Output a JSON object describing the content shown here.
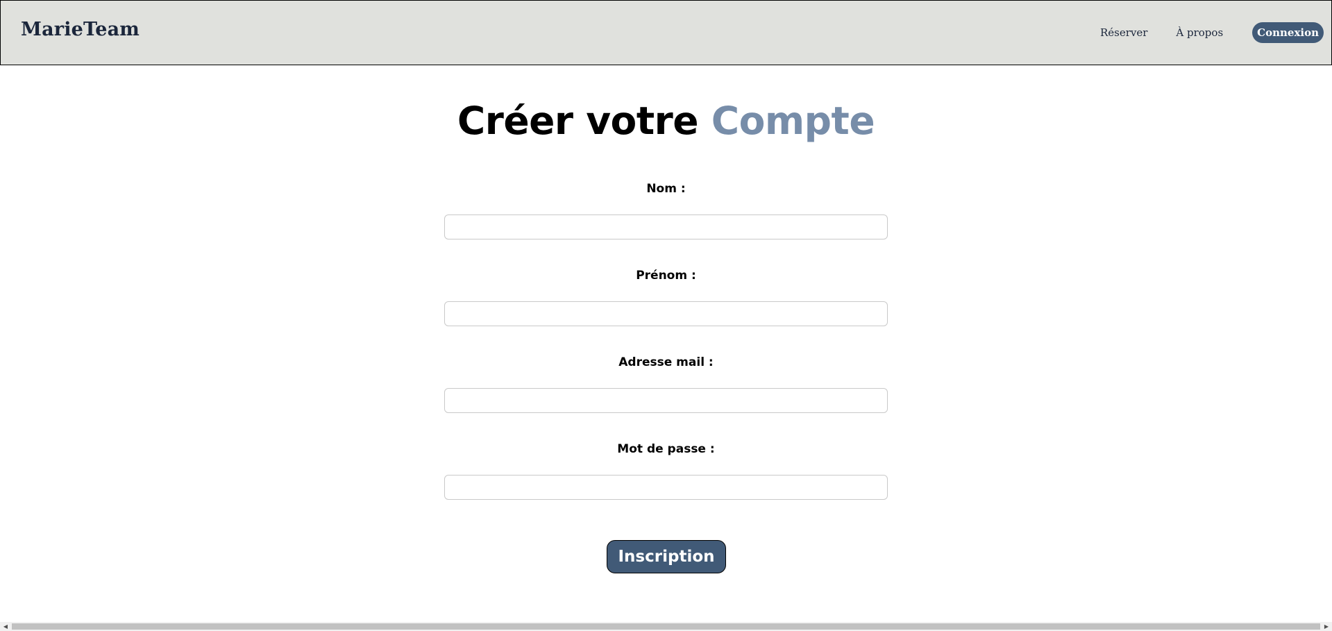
{
  "header": {
    "brand": "MarieTeam",
    "nav": {
      "reserver": "Réserver",
      "a_propos": "À propos",
      "connexion": "Connexion"
    }
  },
  "main": {
    "title_part1": "Créer votre ",
    "title_accent": "Compte",
    "fields": {
      "nom": {
        "label": "Nom :",
        "value": ""
      },
      "prenom": {
        "label": "Prénom :",
        "value": ""
      },
      "email": {
        "label": "Adresse mail :",
        "value": ""
      },
      "password": {
        "label": "Mot de passe :",
        "value": ""
      }
    },
    "submit_label": "Inscription"
  },
  "colors": {
    "header_bg": "#e0e1dd",
    "brand_text": "#1b263b",
    "accent": "#778da9",
    "button_bg": "#415a77",
    "button_text": "#ffffff"
  },
  "icons": {
    "scroll_left": "scroll-left-arrow-icon",
    "scroll_right": "scroll-right-arrow-icon"
  }
}
